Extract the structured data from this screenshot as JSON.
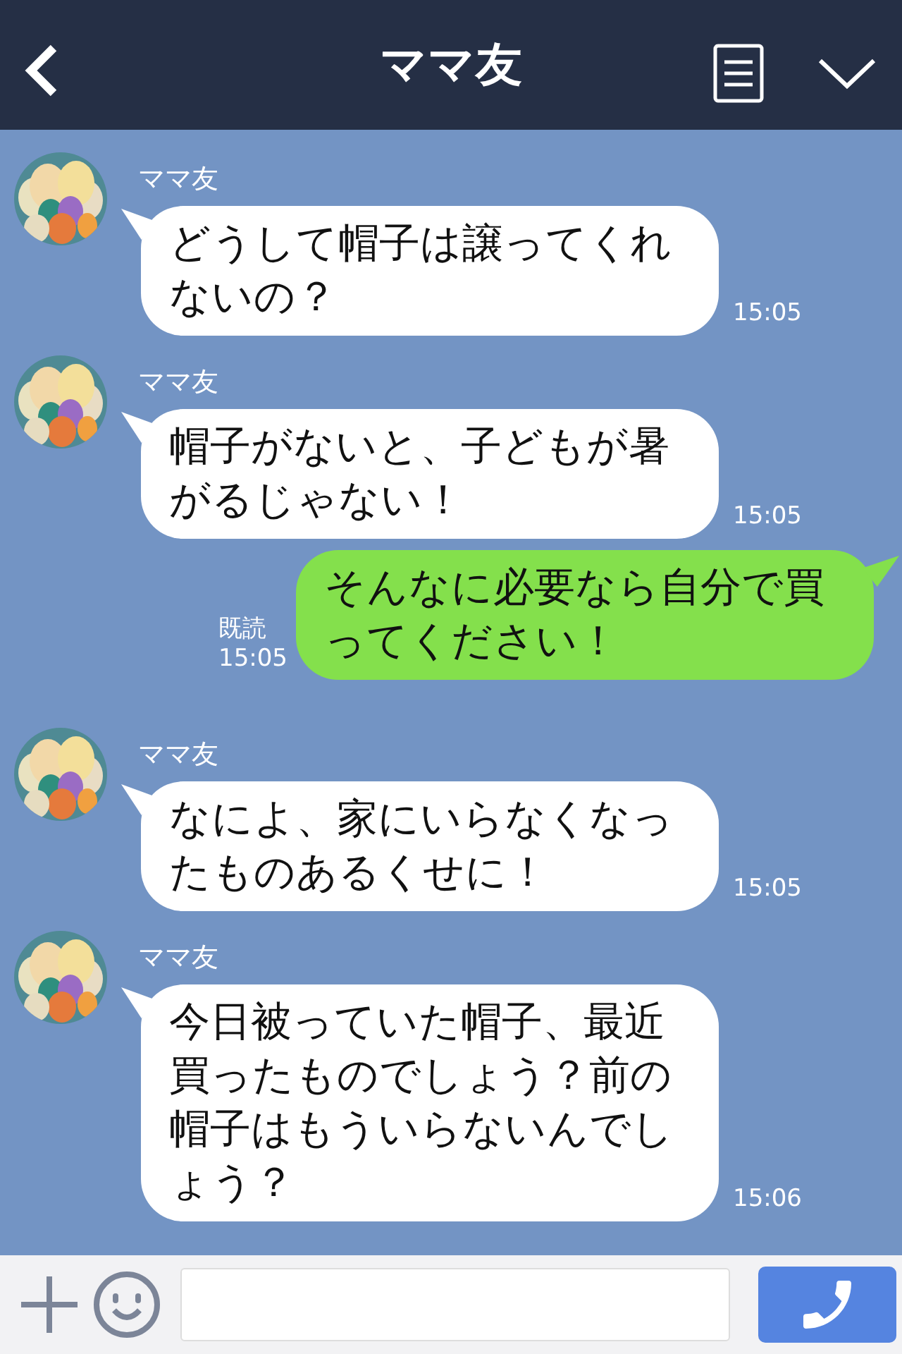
{
  "header": {
    "title": "ママ友"
  },
  "messages": [
    {
      "kind": "incoming",
      "sender": "ママ友",
      "text": "どうして帽子は譲ってくれないの？",
      "time": "15:05"
    },
    {
      "kind": "incoming",
      "sender": "ママ友",
      "text": "帽子がないと、子どもが暑がるじゃない！",
      "time": "15:05"
    },
    {
      "kind": "outgoing",
      "read_label": "既読",
      "text": "そんなに必要なら自分で買ってください！",
      "time": "15:05"
    },
    {
      "kind": "incoming",
      "sender": "ママ友",
      "text": "なによ、家にいらなくなったものあるくせに！",
      "time": "15:05"
    },
    {
      "kind": "incoming",
      "sender": "ママ友",
      "text": "今日被っていた帽子、最近買ったものでしょう？前の帽子はもういらないんでしょう？",
      "time": "15:06"
    }
  ]
}
